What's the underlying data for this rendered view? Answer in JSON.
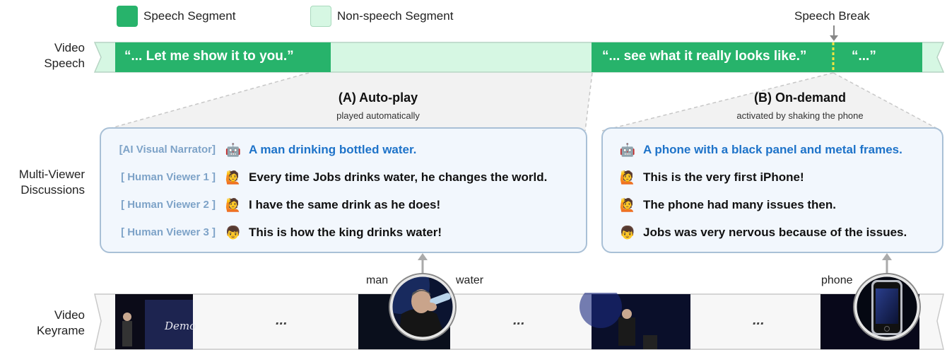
{
  "legend": {
    "speech": "Speech Segment",
    "nonspeech": "Non-speech Segment",
    "speech_color": "#27b36b",
    "nonspeech_color": "#d6f7e3"
  },
  "speech_break_label": "Speech Break",
  "rows": {
    "speech_label_1": "Video",
    "speech_label_2": "Speech",
    "discussion_label_1": "Multi-Viewer",
    "discussion_label_2": "Discussions",
    "keyframe_label_1": "Video",
    "keyframe_label_2": "Keyrame"
  },
  "speech_quotes": {
    "q1": "“... Let me show it to you.”",
    "q2": "“... see what it really looks like.”",
    "q3": "“...”"
  },
  "panel_a": {
    "title": "(A) Auto-play",
    "subtitle": "played automatically",
    "rows": [
      {
        "tag": "[AI Visual Narrator]",
        "emoji": "🤖",
        "text": "A man drinking bottled water."
      },
      {
        "tag": "[ Human Viewer 1 ]",
        "emoji": "🙋",
        "text": "Every time Jobs drinks water, he changes the world."
      },
      {
        "tag": "[ Human Viewer 2 ]",
        "emoji": "🙋",
        "text": "I have the same drink as he does!"
      },
      {
        "tag": "[ Human Viewer 3 ]",
        "emoji": "👦",
        "text": "This is how the king drinks water!"
      }
    ]
  },
  "panel_b": {
    "title": "(B) On-demand",
    "subtitle": "activated by shaking the phone",
    "rows": [
      {
        "emoji": "🤖",
        "text": "A phone with a black panel and metal frames."
      },
      {
        "emoji": "🙋",
        "text": "This is the very first iPhone!"
      },
      {
        "emoji": "🙋",
        "text": "The phone had many issues then."
      },
      {
        "emoji": "👦",
        "text": "Jobs was very nervous because of the issues."
      }
    ]
  },
  "keyframes": {
    "demo_text": "Demo",
    "ellipsis": "...",
    "word_man": "man",
    "word_water": "water",
    "word_phone": "phone"
  }
}
